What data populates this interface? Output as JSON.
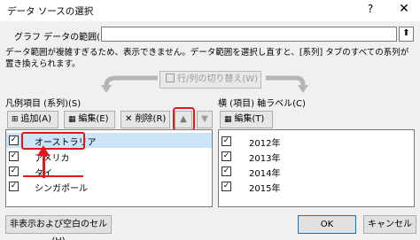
{
  "dialog": {
    "title": "データ ソースの選択",
    "help": "?",
    "close": "✕"
  },
  "range": {
    "label": "グラフ データの範囲(D):",
    "value": "",
    "collapse_icon": "⬆"
  },
  "note": "データ範囲が複雑すぎるため、表示できません。データ範囲を選択し直すと、[系列] タブのすべての系列が置き換えられます。",
  "switch_button": "行/列の切り替え(W)",
  "legend": {
    "label": "凡例項目 (系列)(S)",
    "add": "追加(A)",
    "edit": "編集(E)",
    "delete": "削除(R)",
    "up_icon": "▲",
    "down_icon": "▼",
    "items": [
      {
        "label": "オーストラリア",
        "checked": "✓"
      },
      {
        "label": "アメリカ",
        "checked": "✓"
      },
      {
        "label": "タイ",
        "checked": "✓"
      },
      {
        "label": "シンガポール",
        "checked": "✓"
      }
    ]
  },
  "axis": {
    "label": "横 (項目) 軸ラベル(C)",
    "edit": "編集(T)",
    "items": [
      {
        "label": "2012年",
        "checked": "✓"
      },
      {
        "label": "2013年",
        "checked": "✓"
      },
      {
        "label": "2014年",
        "checked": "✓"
      },
      {
        "label": "2015年",
        "checked": "✓"
      }
    ]
  },
  "buttons": {
    "hidden_cells": "非表示および空白のセル(H)",
    "ok": "OK",
    "cancel": "キャンセル"
  },
  "colors": {
    "highlight": "#e5151c",
    "selection": "#cce4f7"
  }
}
